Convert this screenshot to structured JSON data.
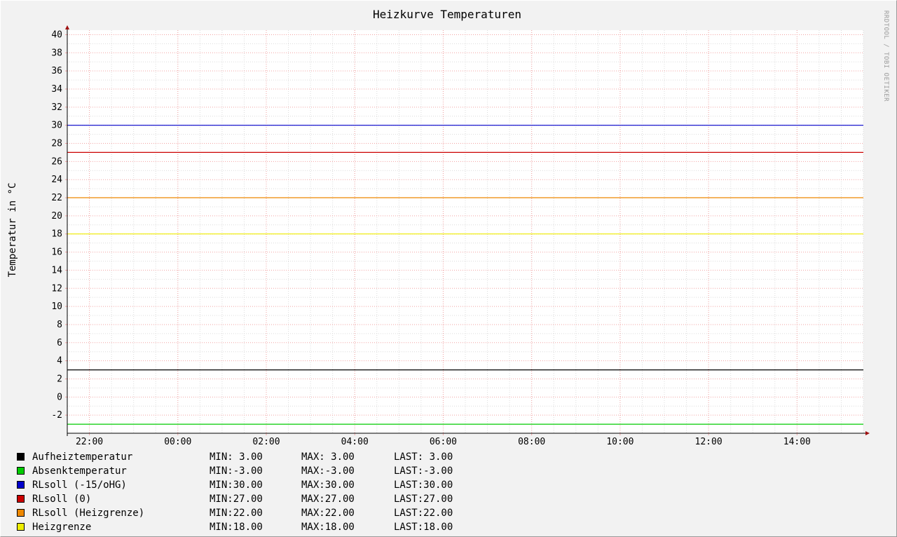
{
  "chart_data": {
    "type": "line",
    "title": "Heizkurve Temperaturen",
    "ylabel": "Temperatur in °C",
    "watermark": "RRDTOOL / TOBI OETIKER",
    "ylim": [
      -4,
      40.5
    ],
    "yticks": [
      -2,
      0,
      2,
      4,
      6,
      8,
      10,
      12,
      14,
      16,
      18,
      20,
      22,
      24,
      26,
      28,
      30,
      32,
      34,
      36,
      38,
      40
    ],
    "xlim": [
      "21:30",
      "15:30"
    ],
    "xticks": [
      "22:00",
      "00:00",
      "02:00",
      "04:00",
      "06:00",
      "08:00",
      "10:00",
      "12:00",
      "14:00"
    ],
    "grid": true,
    "series": [
      {
        "name": "Aufheiztemperatur",
        "color": "#000000",
        "values": [
          3.0,
          3.0
        ],
        "min": "MIN: 3.00",
        "max": "MAX: 3.00",
        "last": "LAST: 3.00"
      },
      {
        "name": "Absenktemperatur",
        "color": "#00cc00",
        "values": [
          -3.0,
          -3.0
        ],
        "min": "MIN:-3.00",
        "max": "MAX:-3.00",
        "last": "LAST:-3.00"
      },
      {
        "name": "RLsoll (-15/oHG)",
        "color": "#0000cc",
        "values": [
          30.0,
          30.0
        ],
        "min": "MIN:30.00",
        "max": "MAX:30.00",
        "last": "LAST:30.00"
      },
      {
        "name": "RLsoll (0)",
        "color": "#cc0000",
        "values": [
          27.0,
          27.0
        ],
        "min": "MIN:27.00",
        "max": "MAX:27.00",
        "last": "LAST:27.00"
      },
      {
        "name": "RLsoll (Heizgrenze)",
        "color": "#ee8800",
        "values": [
          22.0,
          22.0
        ],
        "min": "MIN:22.00",
        "max": "MAX:22.00",
        "last": "LAST:22.00"
      },
      {
        "name": "Heizgrenze",
        "color": "#eeee00",
        "values": [
          18.0,
          18.0
        ],
        "min": "MIN:18.00",
        "max": "MAX:18.00",
        "last": "LAST:18.00"
      }
    ]
  }
}
